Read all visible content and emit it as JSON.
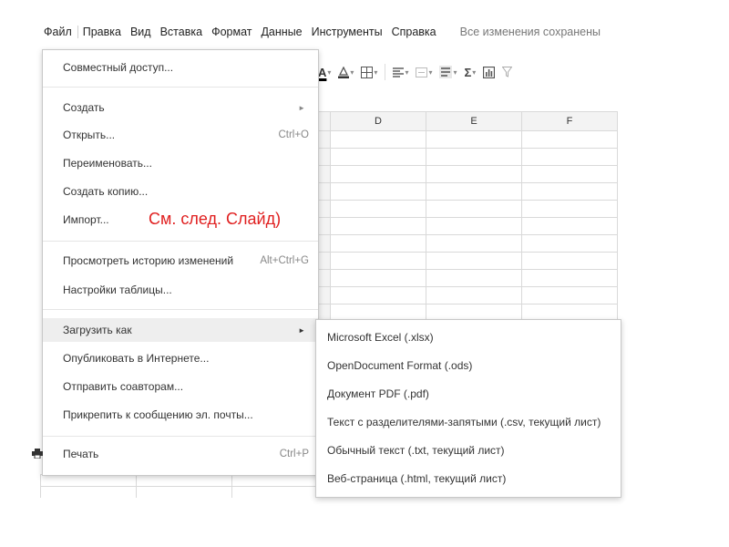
{
  "menubar": {
    "items": [
      "Файл",
      "Правка",
      "Вид",
      "Вставка",
      "Формат",
      "Данные",
      "Инструменты",
      "Справка"
    ],
    "status": "Все изменения сохранены"
  },
  "toolbar": {
    "icons": [
      "text-color-icon",
      "fill-color-icon",
      "borders-icon",
      "align-icon",
      "merge-icon",
      "wrap-icon",
      "functions-icon",
      "chart-icon",
      "filter-icon"
    ],
    "text_color_letter": "A",
    "sigma": "Σ"
  },
  "grid": {
    "columns": [
      "D",
      "E",
      "F"
    ]
  },
  "file_menu": {
    "items": [
      {
        "label": "Совместный доступ...",
        "shortcut": "",
        "submenu": false
      },
      {
        "label": "Создать",
        "shortcut": "",
        "submenu": true
      },
      {
        "label": "Открыть...",
        "shortcut": "Ctrl+O",
        "submenu": false
      },
      {
        "label": "Переименовать...",
        "shortcut": "",
        "submenu": false
      },
      {
        "label": "Создать копию...",
        "shortcut": "",
        "submenu": false
      },
      {
        "label": "Импорт...",
        "shortcut": "",
        "submenu": false
      },
      {
        "label": "Просмотреть историю изменений",
        "shortcut": "Alt+Ctrl+G",
        "submenu": false
      },
      {
        "label": "Настройки таблицы...",
        "shortcut": "",
        "submenu": false
      },
      {
        "label": "Загрузить как",
        "shortcut": "",
        "submenu": true
      },
      {
        "label": "Опубликовать в Интернете...",
        "shortcut": "",
        "submenu": false
      },
      {
        "label": "Отправить соавторам...",
        "shortcut": "",
        "submenu": false
      },
      {
        "label": "Прикрепить к сообщению эл. почты...",
        "shortcut": "",
        "submenu": false
      },
      {
        "label": "Печать",
        "shortcut": "Ctrl+P",
        "submenu": false
      }
    ]
  },
  "annotation": "См. след. Слайд)",
  "download_submenu": {
    "items": [
      "Microsoft Excel (.xlsx)",
      "OpenDocument Format (.ods)",
      "Документ PDF (.pdf)",
      "Текст с разделителями-запятыми (.csv, текущий лист)",
      "Обычный текст (.txt, текущий лист)",
      "Веб-страница (.html, текущий лист)"
    ]
  },
  "colors": {
    "annotation": "#e02020",
    "active_item_bg": "#eeeeee",
    "status_text": "#777777"
  }
}
